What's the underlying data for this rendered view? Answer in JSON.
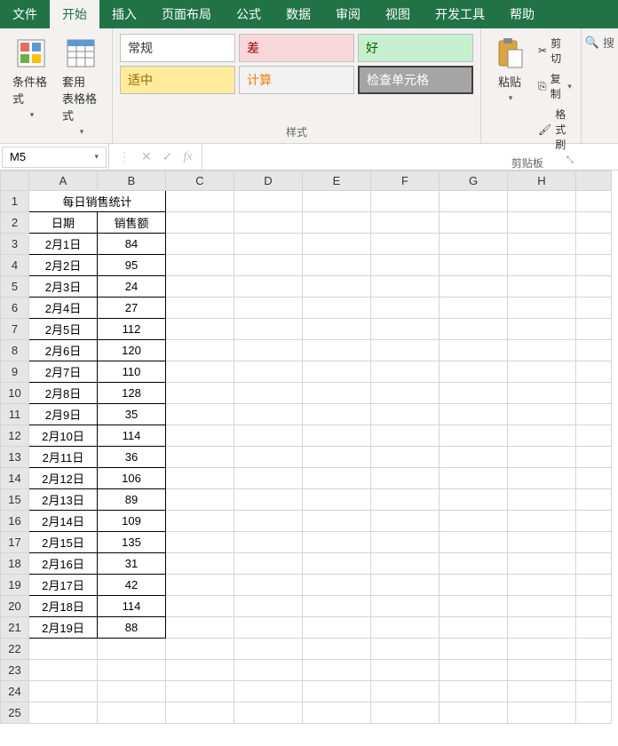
{
  "tabs": [
    "文件",
    "开始",
    "插入",
    "页面布局",
    "公式",
    "数据",
    "审阅",
    "视图",
    "开发工具",
    "帮助"
  ],
  "active_tab_index": 1,
  "ribbon": {
    "cond_format": "条件格式",
    "table_format": "套用\n表格格式",
    "styles_label": "样式",
    "style_cells": [
      "常规",
      "差",
      "好",
      "适中",
      "计算",
      "检查单元格"
    ],
    "paste": "粘贴",
    "clipboard_label": "剪贴板",
    "cut": "剪切",
    "copy": "复制",
    "format_painter": "格式刷",
    "search_hint": "搜"
  },
  "name_box": "M5",
  "formula": "",
  "columns": [
    "A",
    "B",
    "C",
    "D",
    "E",
    "F",
    "G",
    "H"
  ],
  "row_count": 25,
  "title_cell": "每日销售统计",
  "header_row": [
    "日期",
    "销售额"
  ],
  "data_rows": [
    [
      "2月1日",
      "84"
    ],
    [
      "2月2日",
      "95"
    ],
    [
      "2月3日",
      "24"
    ],
    [
      "2月4日",
      "27"
    ],
    [
      "2月5日",
      "112"
    ],
    [
      "2月6日",
      "120"
    ],
    [
      "2月7日",
      "110"
    ],
    [
      "2月8日",
      "128"
    ],
    [
      "2月9日",
      "35"
    ],
    [
      "2月10日",
      "114"
    ],
    [
      "2月11日",
      "36"
    ],
    [
      "2月12日",
      "106"
    ],
    [
      "2月13日",
      "89"
    ],
    [
      "2月14日",
      "109"
    ],
    [
      "2月15日",
      "135"
    ],
    [
      "2月16日",
      "31"
    ],
    [
      "2月17日",
      "42"
    ],
    [
      "2月18日",
      "114"
    ],
    [
      "2月19日",
      "88"
    ]
  ]
}
